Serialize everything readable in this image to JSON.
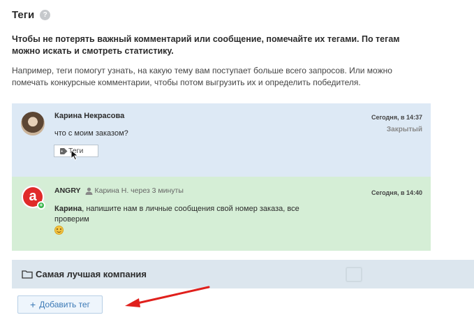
{
  "header": {
    "title": "Теги",
    "help_icon": "question-circle-icon",
    "help_glyph": "?"
  },
  "intro": {
    "lead": "Чтобы не потерять важный комментарий или сообщение, помечайте их тегами. По тегам можно искать и смотреть статистику.",
    "description": "Например, теги помогут узнать, на какую тему вам поступает больше всего запросов. Или можно помечать конкурсные комментарии, чтобы потом выгрузить их и определить победителя."
  },
  "customer_message": {
    "author": "Карина Некрасова",
    "time": "Сегодня, в 14:37",
    "status": "Закрытый",
    "text": "что с моим заказом?",
    "tag_button_label": "Теги",
    "background": "#dde9f5"
  },
  "reply_message": {
    "brand_letter": "a",
    "online_glyph": "+",
    "author": "ANGRY",
    "meta": "Карина Н. через 3 минуты",
    "time": "Сегодня, в 14:40",
    "mention": "Карина",
    "text": ", напишите нам в личные сообщения свой номер заказа, все проверим",
    "background": "#d5eed6"
  },
  "company": {
    "name": "Самая лучшая компания"
  },
  "actions": {
    "add_tag_plus": "+",
    "add_tag_label": "Добавить тег",
    "arrow_color": "#e0201c"
  }
}
